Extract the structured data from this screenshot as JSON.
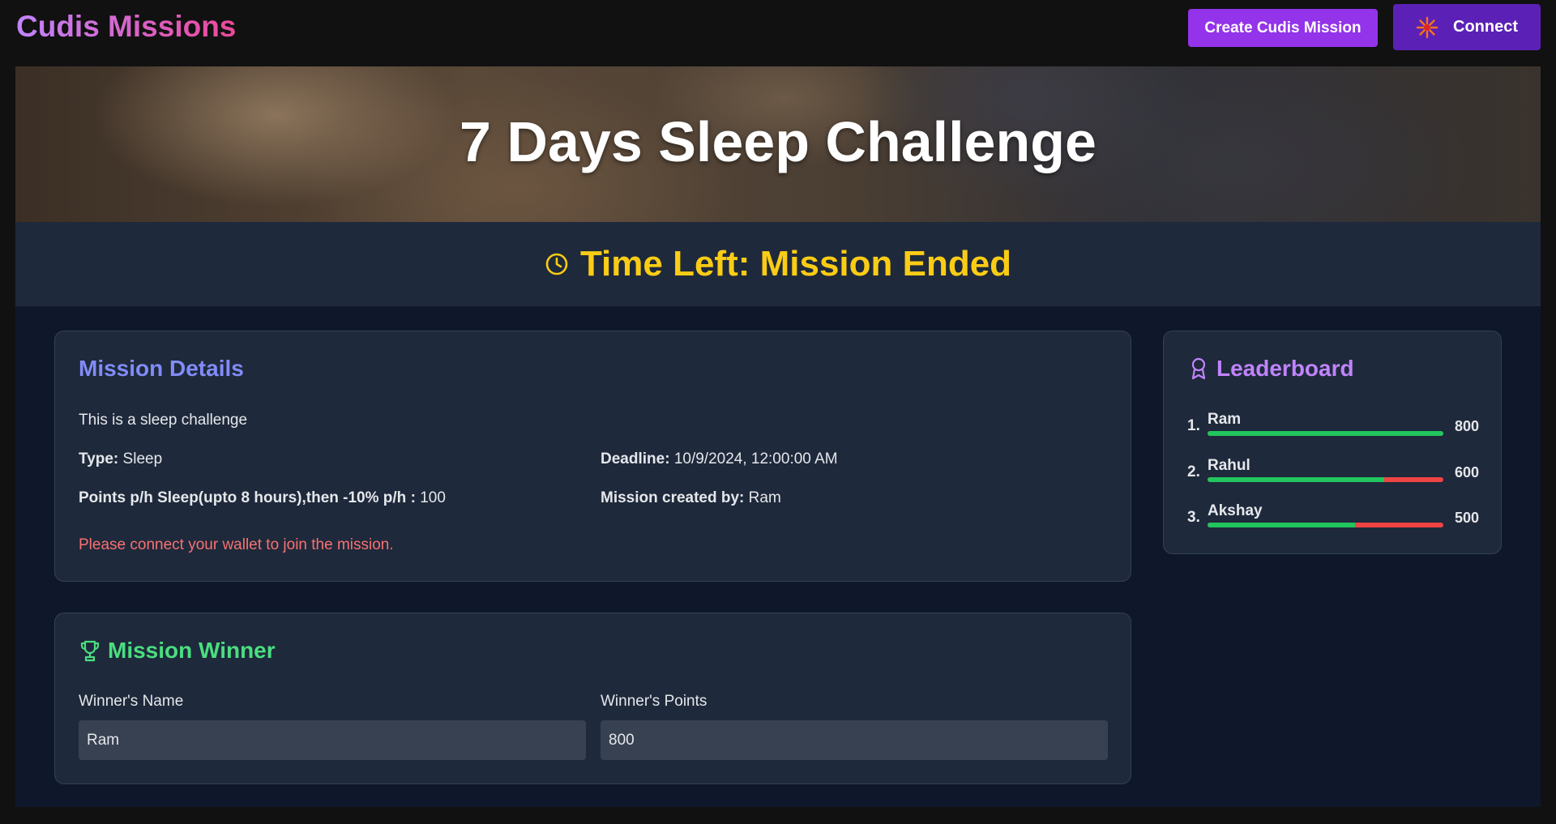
{
  "header": {
    "brand": "Cudis Missions",
    "create_label": "Create Cudis Mission",
    "connect_label": "Connect"
  },
  "hero": {
    "title": "7 Days Sleep Challenge"
  },
  "timer": {
    "text": "Time Left: Mission Ended"
  },
  "details": {
    "title": "Mission Details",
    "description": "This is a sleep challenge",
    "type_label": "Type:",
    "type_value": "Sleep",
    "deadline_label": "Deadline:",
    "deadline_value": "10/9/2024, 12:00:00 AM",
    "points_label": "Points p/h Sleep(upto 8 hours),then -10% p/h :",
    "points_value": "100",
    "creator_label": "Mission created by:",
    "creator_value": "Ram",
    "wallet_warning": "Please connect your wallet to join the mission."
  },
  "winner": {
    "title": "Mission Winner",
    "name_label": "Winner's Name",
    "name_value": "Ram",
    "points_label": "Winner's Points",
    "points_value": "800"
  },
  "leaderboard": {
    "title": "Leaderboard",
    "entries": [
      {
        "rank": "1.",
        "name": "Ram",
        "score": "800",
        "fill": 1.0
      },
      {
        "rank": "2.",
        "name": "Rahul",
        "score": "600",
        "fill": 0.75
      },
      {
        "rank": "3.",
        "name": "Akshay",
        "score": "500",
        "fill": 0.625
      }
    ]
  },
  "colors": {
    "accent_purple": "#9333ea",
    "connect_bg": "#5b21b6",
    "timer": "#facc15",
    "details_title": "#818cf8",
    "winner_title": "#4ade80",
    "leaderboard_title": "#c084fc",
    "warning": "#f87171",
    "bar_good": "#22c55e",
    "bar_bad": "#ef4444"
  },
  "icons": {
    "connect": "sparkle-icon",
    "timer": "clock-icon",
    "winner": "trophy-icon",
    "leaderboard": "award-ribbon-icon"
  }
}
